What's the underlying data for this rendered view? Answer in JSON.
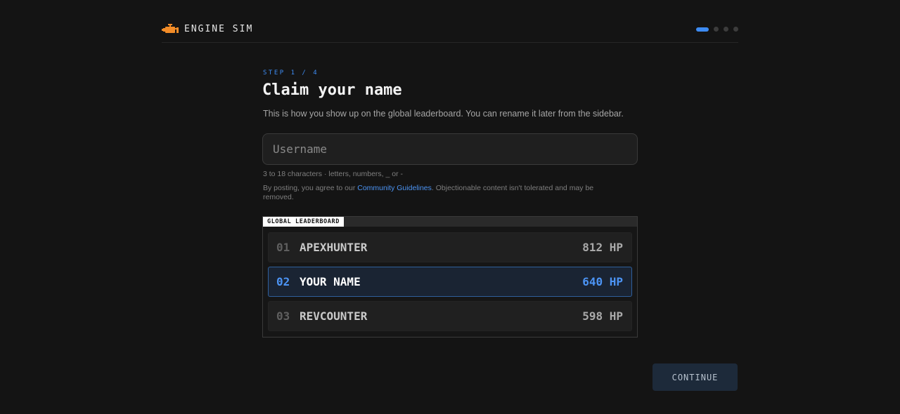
{
  "app": {
    "name": "ENGINE SIM",
    "accent": "#3d8bf2",
    "brand_icon": "engine-icon",
    "brand_color": "#f28c28"
  },
  "progress": {
    "total_steps": 4,
    "current_step": 1
  },
  "onboarding": {
    "step_label": "STEP 1 / 4",
    "title": "Claim your name",
    "subtitle": "This is how you show up on the global leaderboard. You can rename it later from the sidebar.",
    "username_placeholder": "Username",
    "username_value": "",
    "hint": "3 to 18 characters · letters, numbers, _ or -",
    "terms_prefix": "By posting, you agree to our ",
    "terms_link": "Community Guidelines",
    "terms_suffix": ". Objectionable content isn't tolerated and may be removed."
  },
  "leaderboard": {
    "label": "GLOBAL LEADERBOARD",
    "rows": [
      {
        "rank": "01",
        "name": "APEXHUNTER",
        "score": "812 HP",
        "highlight": false
      },
      {
        "rank": "02",
        "name": "YOUR NAME",
        "score": "640 HP",
        "highlight": true
      },
      {
        "rank": "03",
        "name": "REVCOUNTER",
        "score": "598 HP",
        "highlight": false
      }
    ]
  },
  "actions": {
    "continue_label": "CONTINUE"
  }
}
